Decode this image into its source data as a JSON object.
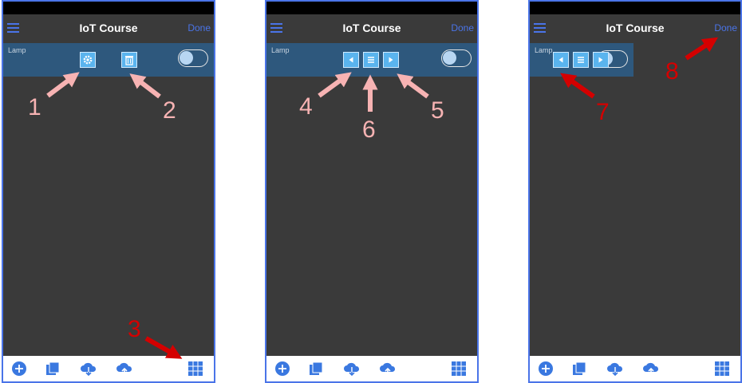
{
  "app": {
    "title": "IoT Course",
    "done_label": "Done"
  },
  "widget": {
    "label": "Lamp"
  },
  "colors": {
    "accent": "#4a74e8",
    "panel_bg": "#3a3a3a",
    "widget_bg": "#2e587d",
    "button": "#5ab4ee",
    "annotation_pink": "#f7b3b3",
    "annotation_red": "#d40000"
  },
  "panels": [
    {
      "buttons": [
        "gear-icon",
        "trash-icon"
      ]
    },
    {
      "buttons": [
        "left-arrow-icon",
        "list-icon",
        "right-arrow-icon"
      ]
    },
    {
      "buttons": [
        "left-arrow-icon",
        "list-icon",
        "right-arrow-icon"
      ]
    }
  ],
  "bottom_icons": [
    "add-circle-icon",
    "copy-icon",
    "cloud-download-icon",
    "cloud-upload-icon",
    "grid-icon"
  ],
  "annotations": [
    "1",
    "2",
    "3",
    "4",
    "5",
    "6",
    "7",
    "8"
  ]
}
